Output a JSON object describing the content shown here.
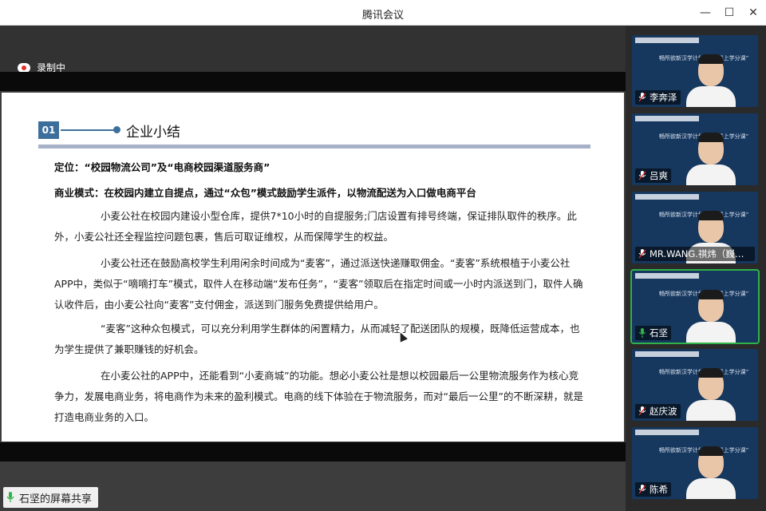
{
  "window": {
    "title": "腾讯会议"
  },
  "recording": {
    "label": "录制中"
  },
  "slide": {
    "number": "01",
    "heading": "企业小结",
    "positioning": "定位：“校园物流公司”及“电商校园渠道服务商”",
    "business_model": "商业模式：在校园内建立自提点，通过“众包”模式鼓励学生派件，以物流配送为入口做电商平台",
    "paragraphs": [
      "小麦公社在校园内建设小型仓库，提供7*10小时的自提服务;门店设置有排号终端，保证排队取件的秩序。此外，小麦公社还全程监控问题包裹，售后可取证维权，从而保障学生的权益。",
      "小麦公社还在鼓励高校学生利用闲余时间成为“麦客”，通过派送快递赚取佣金。“麦客”系统根植于小麦公社APP中，类似于“嘀嘀打车”模式，取件人在移动端“发布任务”，“麦客”领取后在指定时间或一小时内派送到门，取件人确认收件后，由小麦公社向“麦客”支付佣金，派送到门服务免费提供给用户。",
      "“麦客”这种众包模式，可以充分利用学生群体的闲置精力，从而减轻了配送团队的规模，既降低运营成本，也为学生提供了兼职赚钱的好机会。",
      "在小麦公社的APP中，还能看到“小麦商城”的功能。想必小麦公社是想以校园最后一公里物流服务作为核心竞争力，发展电商业务，将电商作为未来的盈利模式。电商的线下体验在于物流服务，而对“最后一公里”的不断深耕，就是打造电商业务的入口。"
    ]
  },
  "share_status": {
    "label": "石坚的屏幕共享"
  },
  "participants": [
    {
      "name": "李奔泽",
      "muted": true,
      "active": false
    },
    {
      "name": "吕爽",
      "muted": true,
      "active": false
    },
    {
      "name": "MR.WANG.祺炜（巍）1...",
      "muted": true,
      "active": false
    },
    {
      "name": "石坚",
      "muted": false,
      "active": true
    },
    {
      "name": "赵庆波",
      "muted": true,
      "active": false
    },
    {
      "name": "陈希",
      "muted": true,
      "active": false
    }
  ],
  "tile_banner_text": "畅所欲新汉学计划“海外线上学分课”",
  "colors": {
    "accent": "#3d6f9c",
    "speaking": "#2fb24a",
    "muted": "#e0302f"
  }
}
